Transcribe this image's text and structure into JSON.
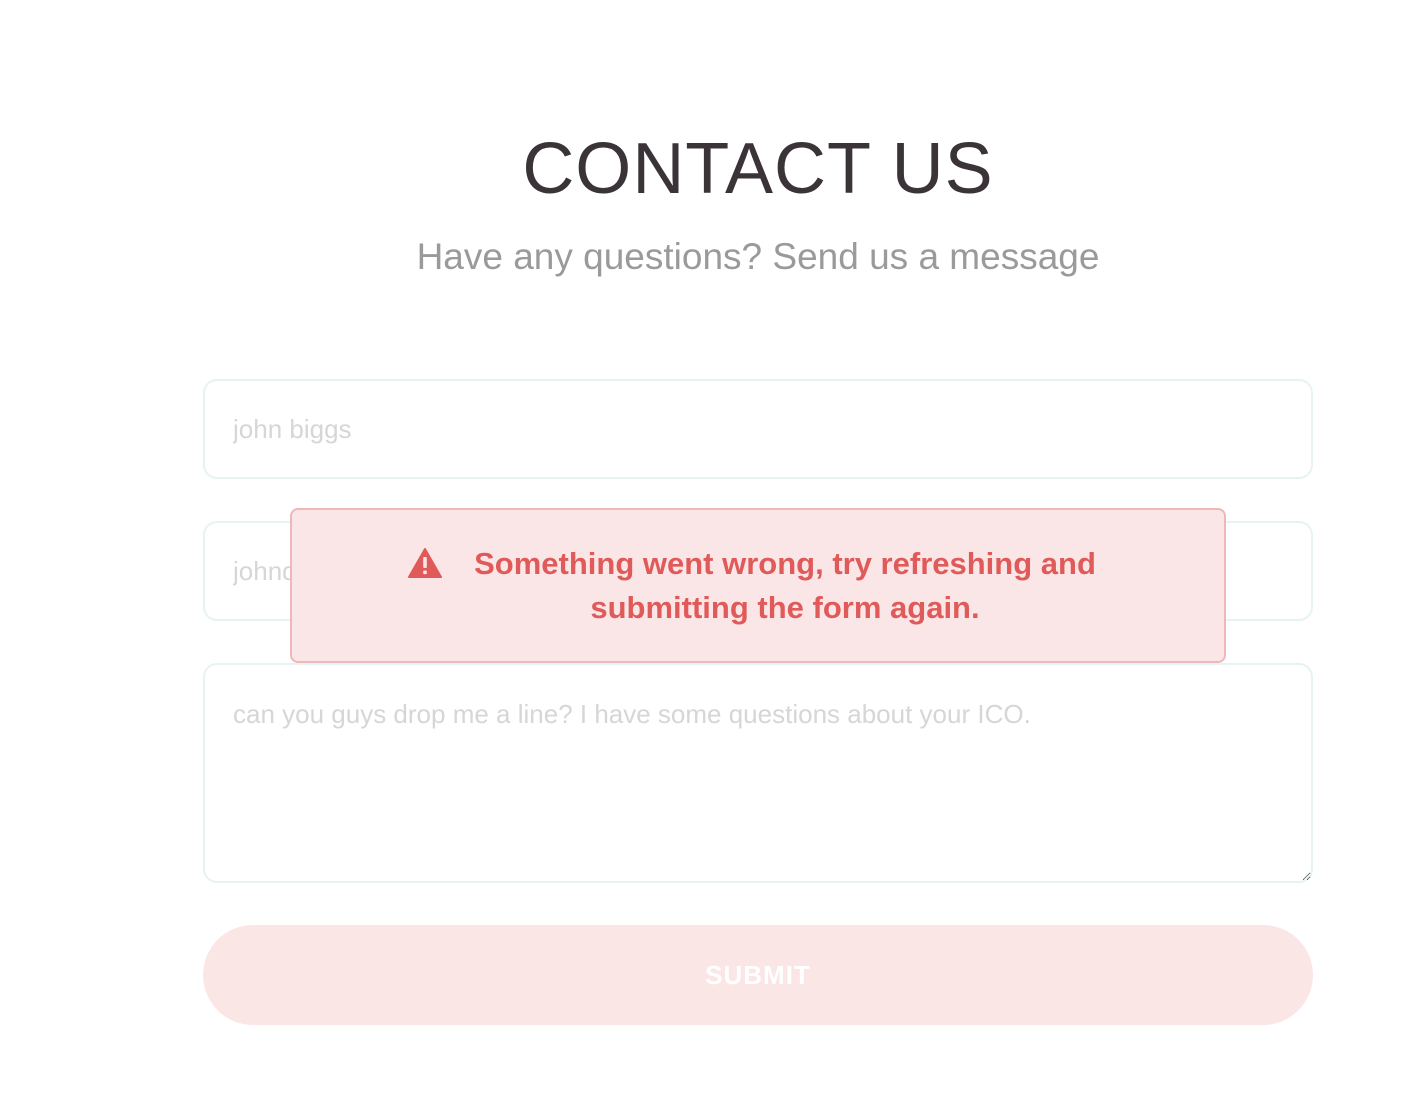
{
  "header": {
    "title": "CONTACT US",
    "subtitle": "Have any questions? Send us a message"
  },
  "form": {
    "name_placeholder": "john biggs",
    "email_placeholder": "johndoe@example.com",
    "message_placeholder": "can you guys drop me a line? I have some questions about your ICO.",
    "submit_label": "SUBMIT"
  },
  "alert": {
    "icon": "warning-icon",
    "message": "Something went wrong, try refreshing and submitting the form again.",
    "colors": {
      "text": "#e05a5a",
      "background": "#fae6e6",
      "border": "#efb8b8"
    }
  },
  "colors": {
    "title": "#3a3338",
    "subtitle": "#9a9a9a",
    "field_border": "#e5f4f2",
    "button_background": "#fbe6e6"
  }
}
